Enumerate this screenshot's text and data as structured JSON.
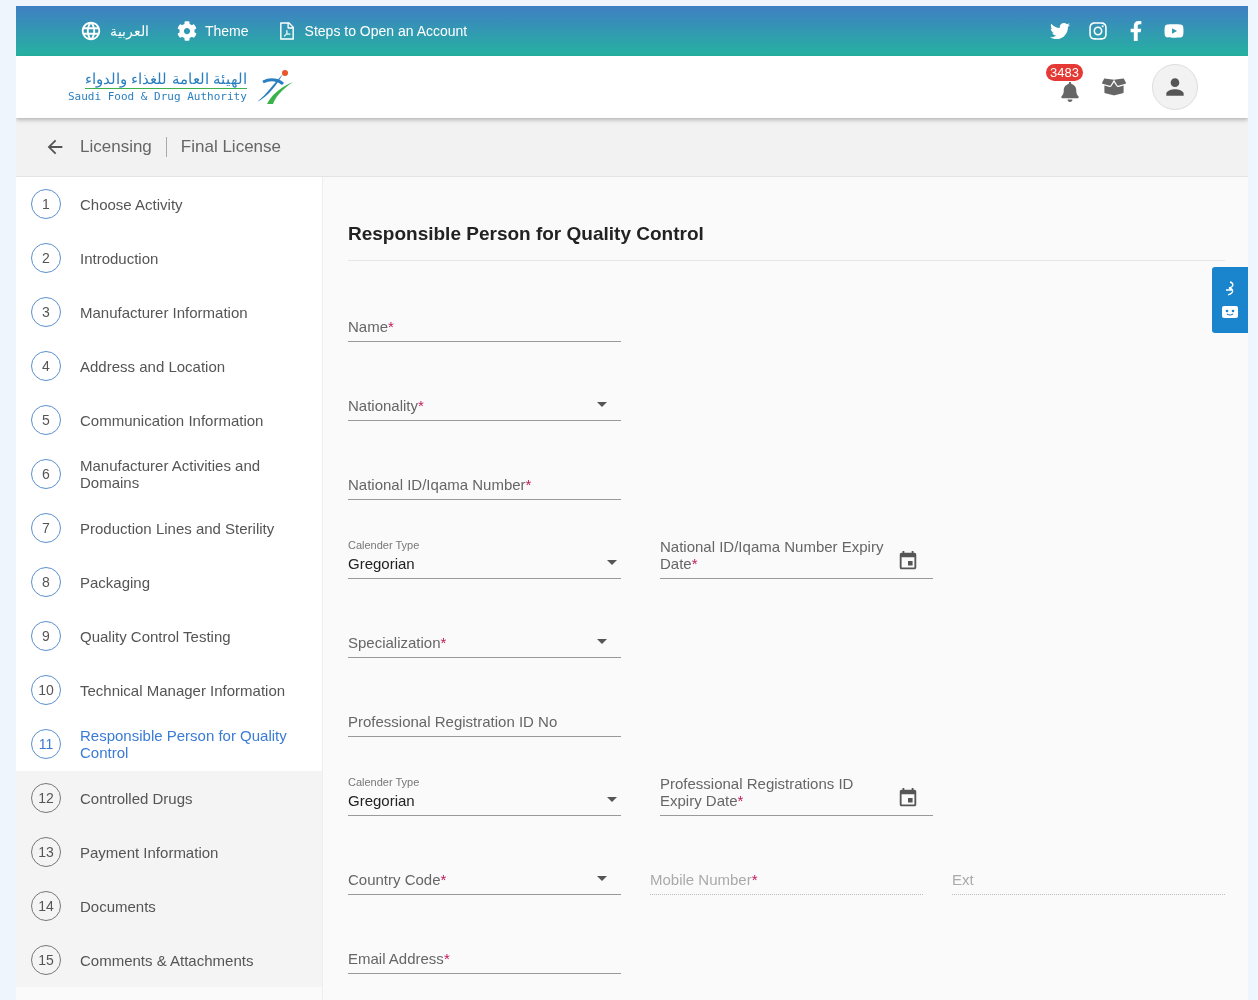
{
  "top_bar": {
    "language": "العربية",
    "theme": "Theme",
    "steps_link": "Steps to Open an Account"
  },
  "logo": {
    "arabic": "الهيئة العامة للغذاء والدواء",
    "english": "Saudi Food & Drug Authority"
  },
  "notifications": {
    "count": "3483"
  },
  "breadcrumb": [
    "Licensing",
    "Final License"
  ],
  "steps": [
    {
      "number": "1",
      "label": "Choose Activity",
      "selected": false,
      "disabled": false
    },
    {
      "number": "2",
      "label": "Introduction",
      "selected": false,
      "disabled": false
    },
    {
      "number": "3",
      "label": "Manufacturer Information",
      "selected": false,
      "disabled": false
    },
    {
      "number": "4",
      "label": "Address and Location",
      "selected": false,
      "disabled": false
    },
    {
      "number": "5",
      "label": "Communication Information",
      "selected": false,
      "disabled": false
    },
    {
      "number": "6",
      "label": "Manufacturer Activities and Domains",
      "selected": false,
      "disabled": false
    },
    {
      "number": "7",
      "label": "Production Lines and Sterility",
      "selected": false,
      "disabled": false
    },
    {
      "number": "8",
      "label": "Packaging",
      "selected": false,
      "disabled": false
    },
    {
      "number": "9",
      "label": "Quality Control Testing",
      "selected": false,
      "disabled": false
    },
    {
      "number": "10",
      "label": "Technical Manager Information",
      "selected": false,
      "disabled": false
    },
    {
      "number": "11",
      "label": "Responsible Person for Quality Control",
      "selected": true,
      "disabled": false
    },
    {
      "number": "12",
      "label": "Controlled Drugs",
      "selected": false,
      "disabled": true
    },
    {
      "number": "13",
      "label": "Payment Information",
      "selected": false,
      "disabled": true
    },
    {
      "number": "14",
      "label": "Documents",
      "selected": false,
      "disabled": true
    },
    {
      "number": "15",
      "label": "Comments & Attachments",
      "selected": false,
      "disabled": true
    }
  ],
  "form": {
    "title": "Responsible Person for Quality Control",
    "rows": [
      {
        "fields": [
          {
            "kind": "text",
            "label": "Name",
            "required_mark": "*",
            "disabled": false
          }
        ]
      },
      {
        "fields": [
          {
            "kind": "select",
            "label": "Nationality",
            "required_mark": "*",
            "disabled": false
          }
        ]
      },
      {
        "fields": [
          {
            "kind": "text",
            "label": "National ID/Iqama Number",
            "required_mark": "*",
            "disabled": false
          }
        ]
      },
      {
        "fields": [
          {
            "kind": "calendar",
            "label": "Calender Type",
            "value": "Gregorian",
            "disabled": false
          },
          {
            "kind": "date",
            "label": "National ID/Iqama Number Expiry Date",
            "required_mark": "*",
            "disabled": false
          }
        ]
      },
      {
        "fields": [
          {
            "kind": "select",
            "label": "Specialization",
            "required_mark": "*",
            "disabled": false
          }
        ]
      },
      {
        "fields": [
          {
            "kind": "text",
            "label": "Professional Registration ID No",
            "disabled": false
          }
        ]
      },
      {
        "fields": [
          {
            "kind": "calendar",
            "label": "Calender Type",
            "value": "Gregorian",
            "disabled": false
          },
          {
            "kind": "date",
            "label": "Professional Registrations ID Expiry Date",
            "required_mark": "*",
            "disabled": false
          }
        ]
      },
      {
        "fields": [
          {
            "kind": "select",
            "label": "Country Code",
            "required_mark": "*",
            "disabled": false
          },
          {
            "kind": "text",
            "label": "Mobile Number",
            "required_mark": "*",
            "disabled": true
          },
          {
            "kind": "text",
            "label": "Ext",
            "disabled": true
          }
        ]
      },
      {
        "fields": [
          {
            "kind": "text",
            "label": "Email Address",
            "required_mark": "*",
            "disabled": false
          }
        ]
      }
    ]
  }
}
